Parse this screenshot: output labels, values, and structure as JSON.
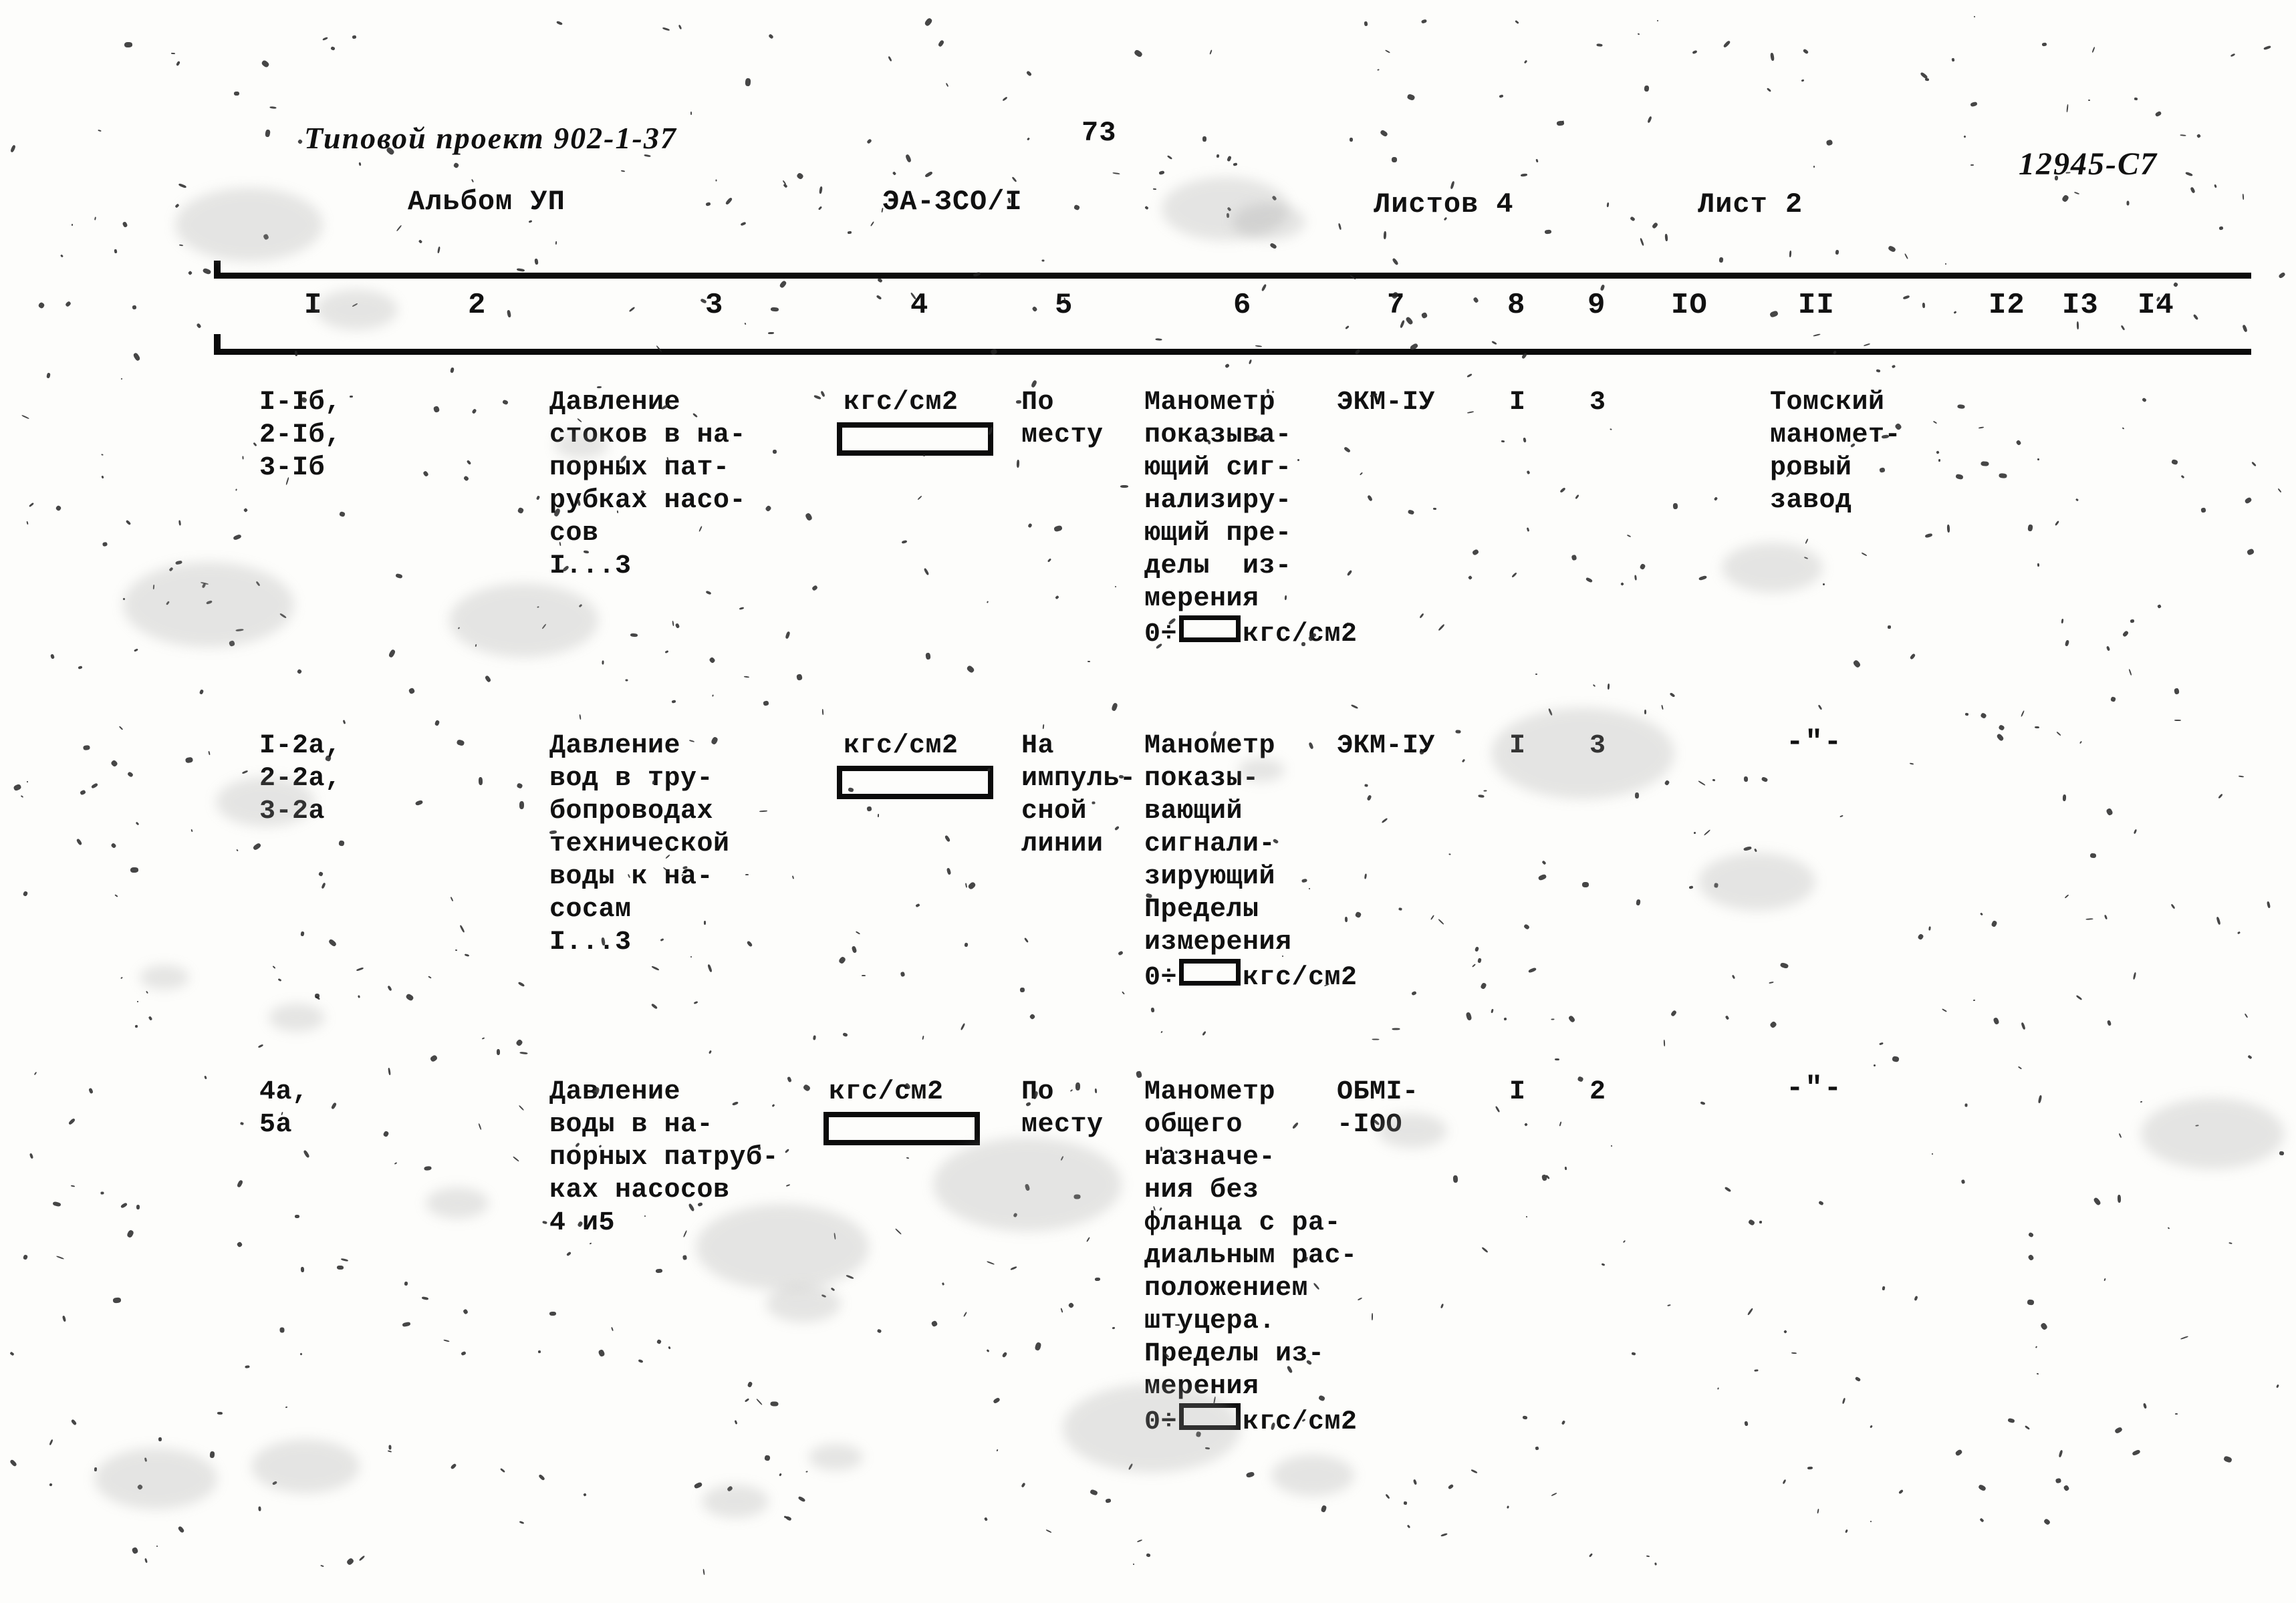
{
  "header": {
    "project_label": "Типовой проект 902-1-37",
    "album_label": "Альбом УП",
    "doc_code": "ЭА-ЗСО/I",
    "page_number": "73",
    "sheets_total": "Листов 4",
    "sheet_current": "Лист 2",
    "document_number": "12945-С7"
  },
  "table": {
    "column_numbers": [
      "I",
      "2",
      "3",
      "4",
      "5",
      "6",
      "7",
      "8",
      "9",
      "IO",
      "II",
      "I2",
      "I3",
      "I4"
    ],
    "rows": [
      {
        "position": "I-Iб,\n2-Iб,\n3-Iб",
        "parameter": "Давление\nстоков в на-\nпорных пат-\nрубках насо-\nсов\nI...3",
        "unit_label": "кгс/см2",
        "unit_value": "",
        "location": "По\nместу",
        "device_description_pre": "Манометр\nпоказыва-\nющий сиг-\nнализиру-\nющий пре-\nделы  из-\nмерения\n",
        "device_range_prefix": "0÷",
        "device_range_value": "",
        "device_range_suffix": "кгс/см2",
        "device_type": "ЭКМ-IУ",
        "col8": "I",
        "col9": "3",
        "manufacturer": "Томский\nманомет-\nровый\nзавод",
        "manufacturer_ditto": false
      },
      {
        "position": "I-2a,\n2-2a,\n3-2a",
        "parameter": "Давление\nвод в тру-\nбопроводах\nтехнической\nводы к на-\nсосам\nI...3",
        "unit_label": "кгс/см2",
        "unit_value": "",
        "location": "На\nимпуль-\nсной\nлинии",
        "device_description_pre": "Манометр\nпоказы-\nвающий\nсигнали-\nзирующий\nПределы\nизмерения\n",
        "device_range_prefix": "0÷",
        "device_range_value": "",
        "device_range_suffix": "кгс/см2",
        "device_type": "ЭКМ-IУ",
        "col8": "I",
        "col9": "3",
        "manufacturer": "-\"-",
        "manufacturer_ditto": true
      },
      {
        "position": "4а,\n5а",
        "parameter": "Давление\nводы в на-\nпорных патруб-\nках насосов\n4 и5",
        "unit_label": "кгс/см2",
        "unit_value": "",
        "location": "По\nместу",
        "device_description_pre": "Манометр\nобщего\nназначе-\nния без\nфланца с ра-\nдиальным рас-\nположением\nштуцера.\nПределы из-\nмерения\n",
        "device_range_prefix": "0÷",
        "device_range_value": "",
        "device_range_suffix": "кгс/см2",
        "device_type": "ОБМI-\n-IOO",
        "col8": "I",
        "col9": "2",
        "manufacturer": "-\"-",
        "manufacturer_ditto": true
      }
    ]
  },
  "colors": {
    "ink": "#0b0b0b",
    "paper": "#fdfdfb"
  }
}
